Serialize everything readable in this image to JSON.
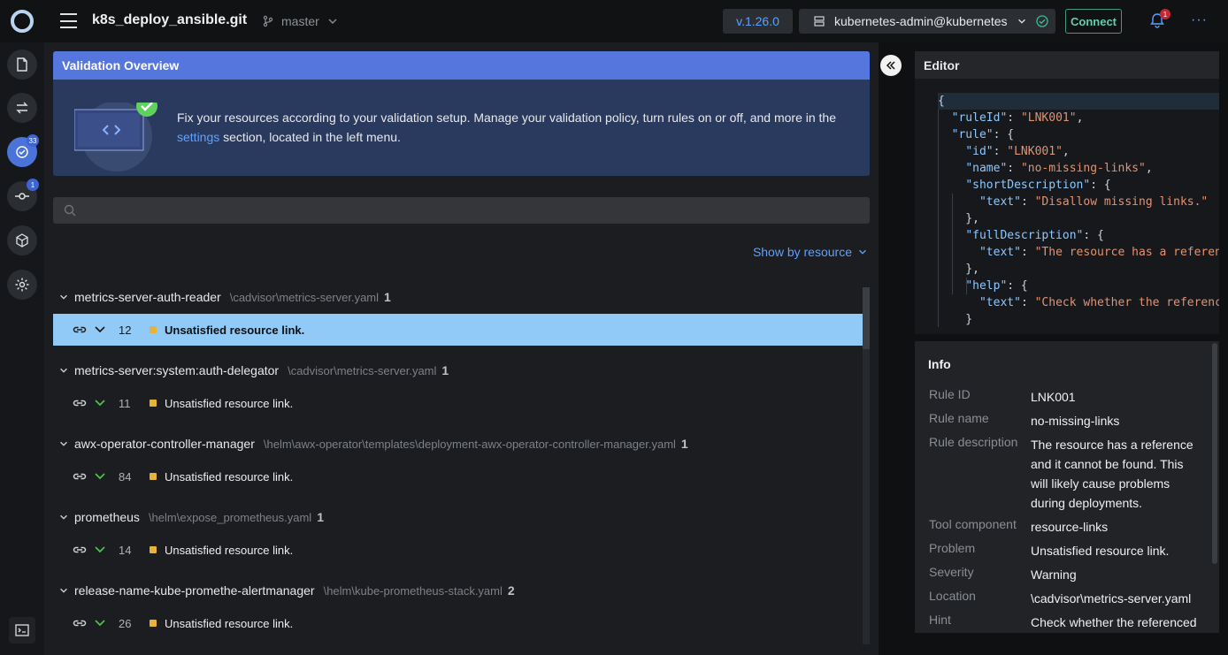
{
  "header": {
    "project_name": "k8s_deploy_ansible.git",
    "branch": "master",
    "version": "v.1.26.0",
    "cluster": "kubernetes-admin@kubernetes",
    "connect_label": "Connect",
    "notification_count": "1"
  },
  "leftnav": {
    "validation_badge": "33",
    "git_badge": "1"
  },
  "overview": {
    "title": "Validation Overview",
    "text_before": "Fix your resources according to your validation setup. Manage your validation policy, turn rules on or off, and more in the",
    "link": "settings",
    "text_after": "section, located in the left menu."
  },
  "search": {
    "placeholder": ""
  },
  "show_by": "Show by resource",
  "groups": [
    {
      "name": "metrics-server-auth-reader",
      "path": "\\cadvisor\\metrics-server.yaml",
      "count": "1",
      "line": "12",
      "message": "Unsatisfied resource link."
    },
    {
      "name": "metrics-server:system:auth-delegator",
      "path": "\\cadvisor\\metrics-server.yaml",
      "count": "1",
      "line": "11",
      "message": "Unsatisfied resource link."
    },
    {
      "name": "awx-operator-controller-manager",
      "path": "\\helm\\awx-operator\\templates\\deployment-awx-operator-controller-manager.yaml",
      "count": "1",
      "line": "84",
      "message": "Unsatisfied resource link."
    },
    {
      "name": "prometheus",
      "path": "\\helm\\expose_prometheus.yaml",
      "count": "1",
      "line": "14",
      "message": "Unsatisfied resource link."
    },
    {
      "name": "release-name-kube-promethe-alertmanager",
      "path": "\\helm\\kube-prometheus-stack.yaml",
      "count": "2",
      "line": "26",
      "message": "Unsatisfied resource link."
    }
  ],
  "editor": {
    "title": "Editor",
    "lines": [
      "{",
      "  \"ruleId\": \"LNK001\",",
      "  \"rule\": {",
      "    \"id\": \"LNK001\",",
      "    \"name\": \"no-missing-links\",",
      "    \"shortDescription\": {",
      "      \"text\": \"Disallow missing links.\"",
      "    },",
      "    \"fullDescription\": {",
      "      \"text\": \"The resource has a reference",
      "    },",
      "    \"help\": {",
      "      \"text\": \"Check whether the reference",
      "    }"
    ]
  },
  "info": {
    "title": "Info",
    "rows": [
      {
        "label": "Rule ID",
        "value": "LNK001"
      },
      {
        "label": "Rule name",
        "value": "no-missing-links"
      },
      {
        "label": "Rule description",
        "value": "The resource has a reference and it cannot be found. This will likely cause problems during deployments."
      },
      {
        "label": "Tool component",
        "value": "resource-links"
      },
      {
        "label": "Problem",
        "value": "Unsatisfied resource link."
      },
      {
        "label": "Severity",
        "value": "Warning"
      },
      {
        "label": "Location",
        "value": "\\cadvisor\\metrics-server.yaml"
      },
      {
        "label": "Hint",
        "value": "Check whether the referenced"
      }
    ]
  },
  "colors": {
    "accent": "#5577dd",
    "link": "#5ea1ff",
    "selected_row": "#91caf7",
    "warning": "#e5b33a",
    "connect": "#5fd1ab"
  }
}
